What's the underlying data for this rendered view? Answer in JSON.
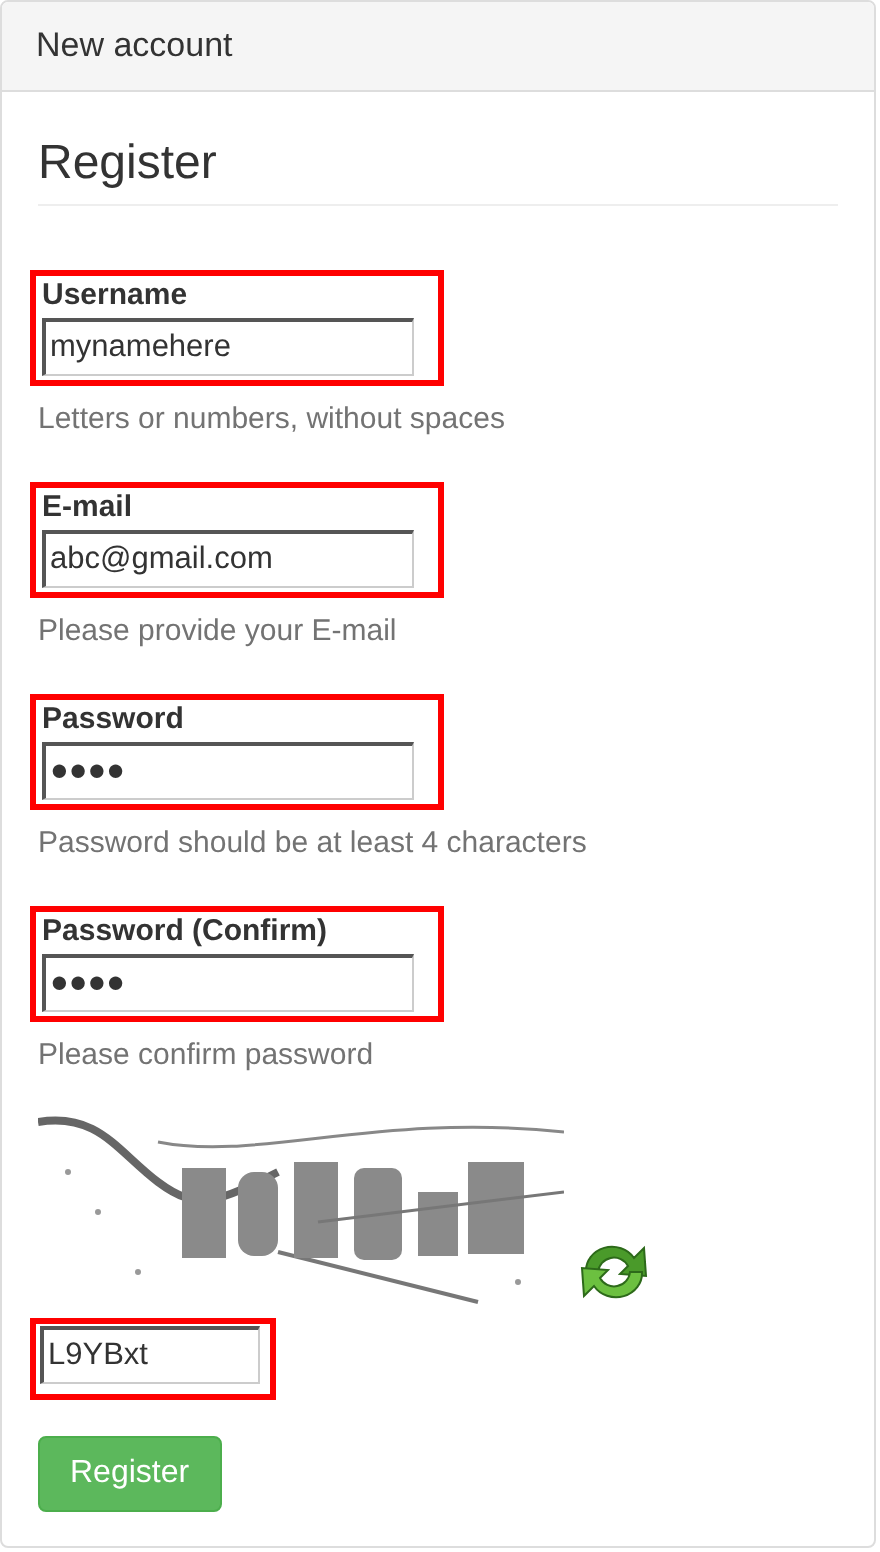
{
  "panel": {
    "title": "New account"
  },
  "form": {
    "heading": "Register",
    "fields": [
      {
        "label": "Username",
        "value": "mynamehere",
        "help": "Letters or numbers, without spaces",
        "highlighted": true
      },
      {
        "label": "E-mail",
        "value": "abc@gmail.com",
        "help": "Please provide your E-mail",
        "highlighted": true
      },
      {
        "label": "Password",
        "value": "●●●●",
        "help": "Password should be at least 4 characters",
        "highlighted": true
      },
      {
        "label": "Password (Confirm)",
        "value": "●●●●",
        "help": "Please confirm password",
        "highlighted": true
      }
    ],
    "captcha": {
      "kind": "picture",
      "value": "L9YBxt",
      "highlighted": true
    },
    "submit": "Register"
  }
}
